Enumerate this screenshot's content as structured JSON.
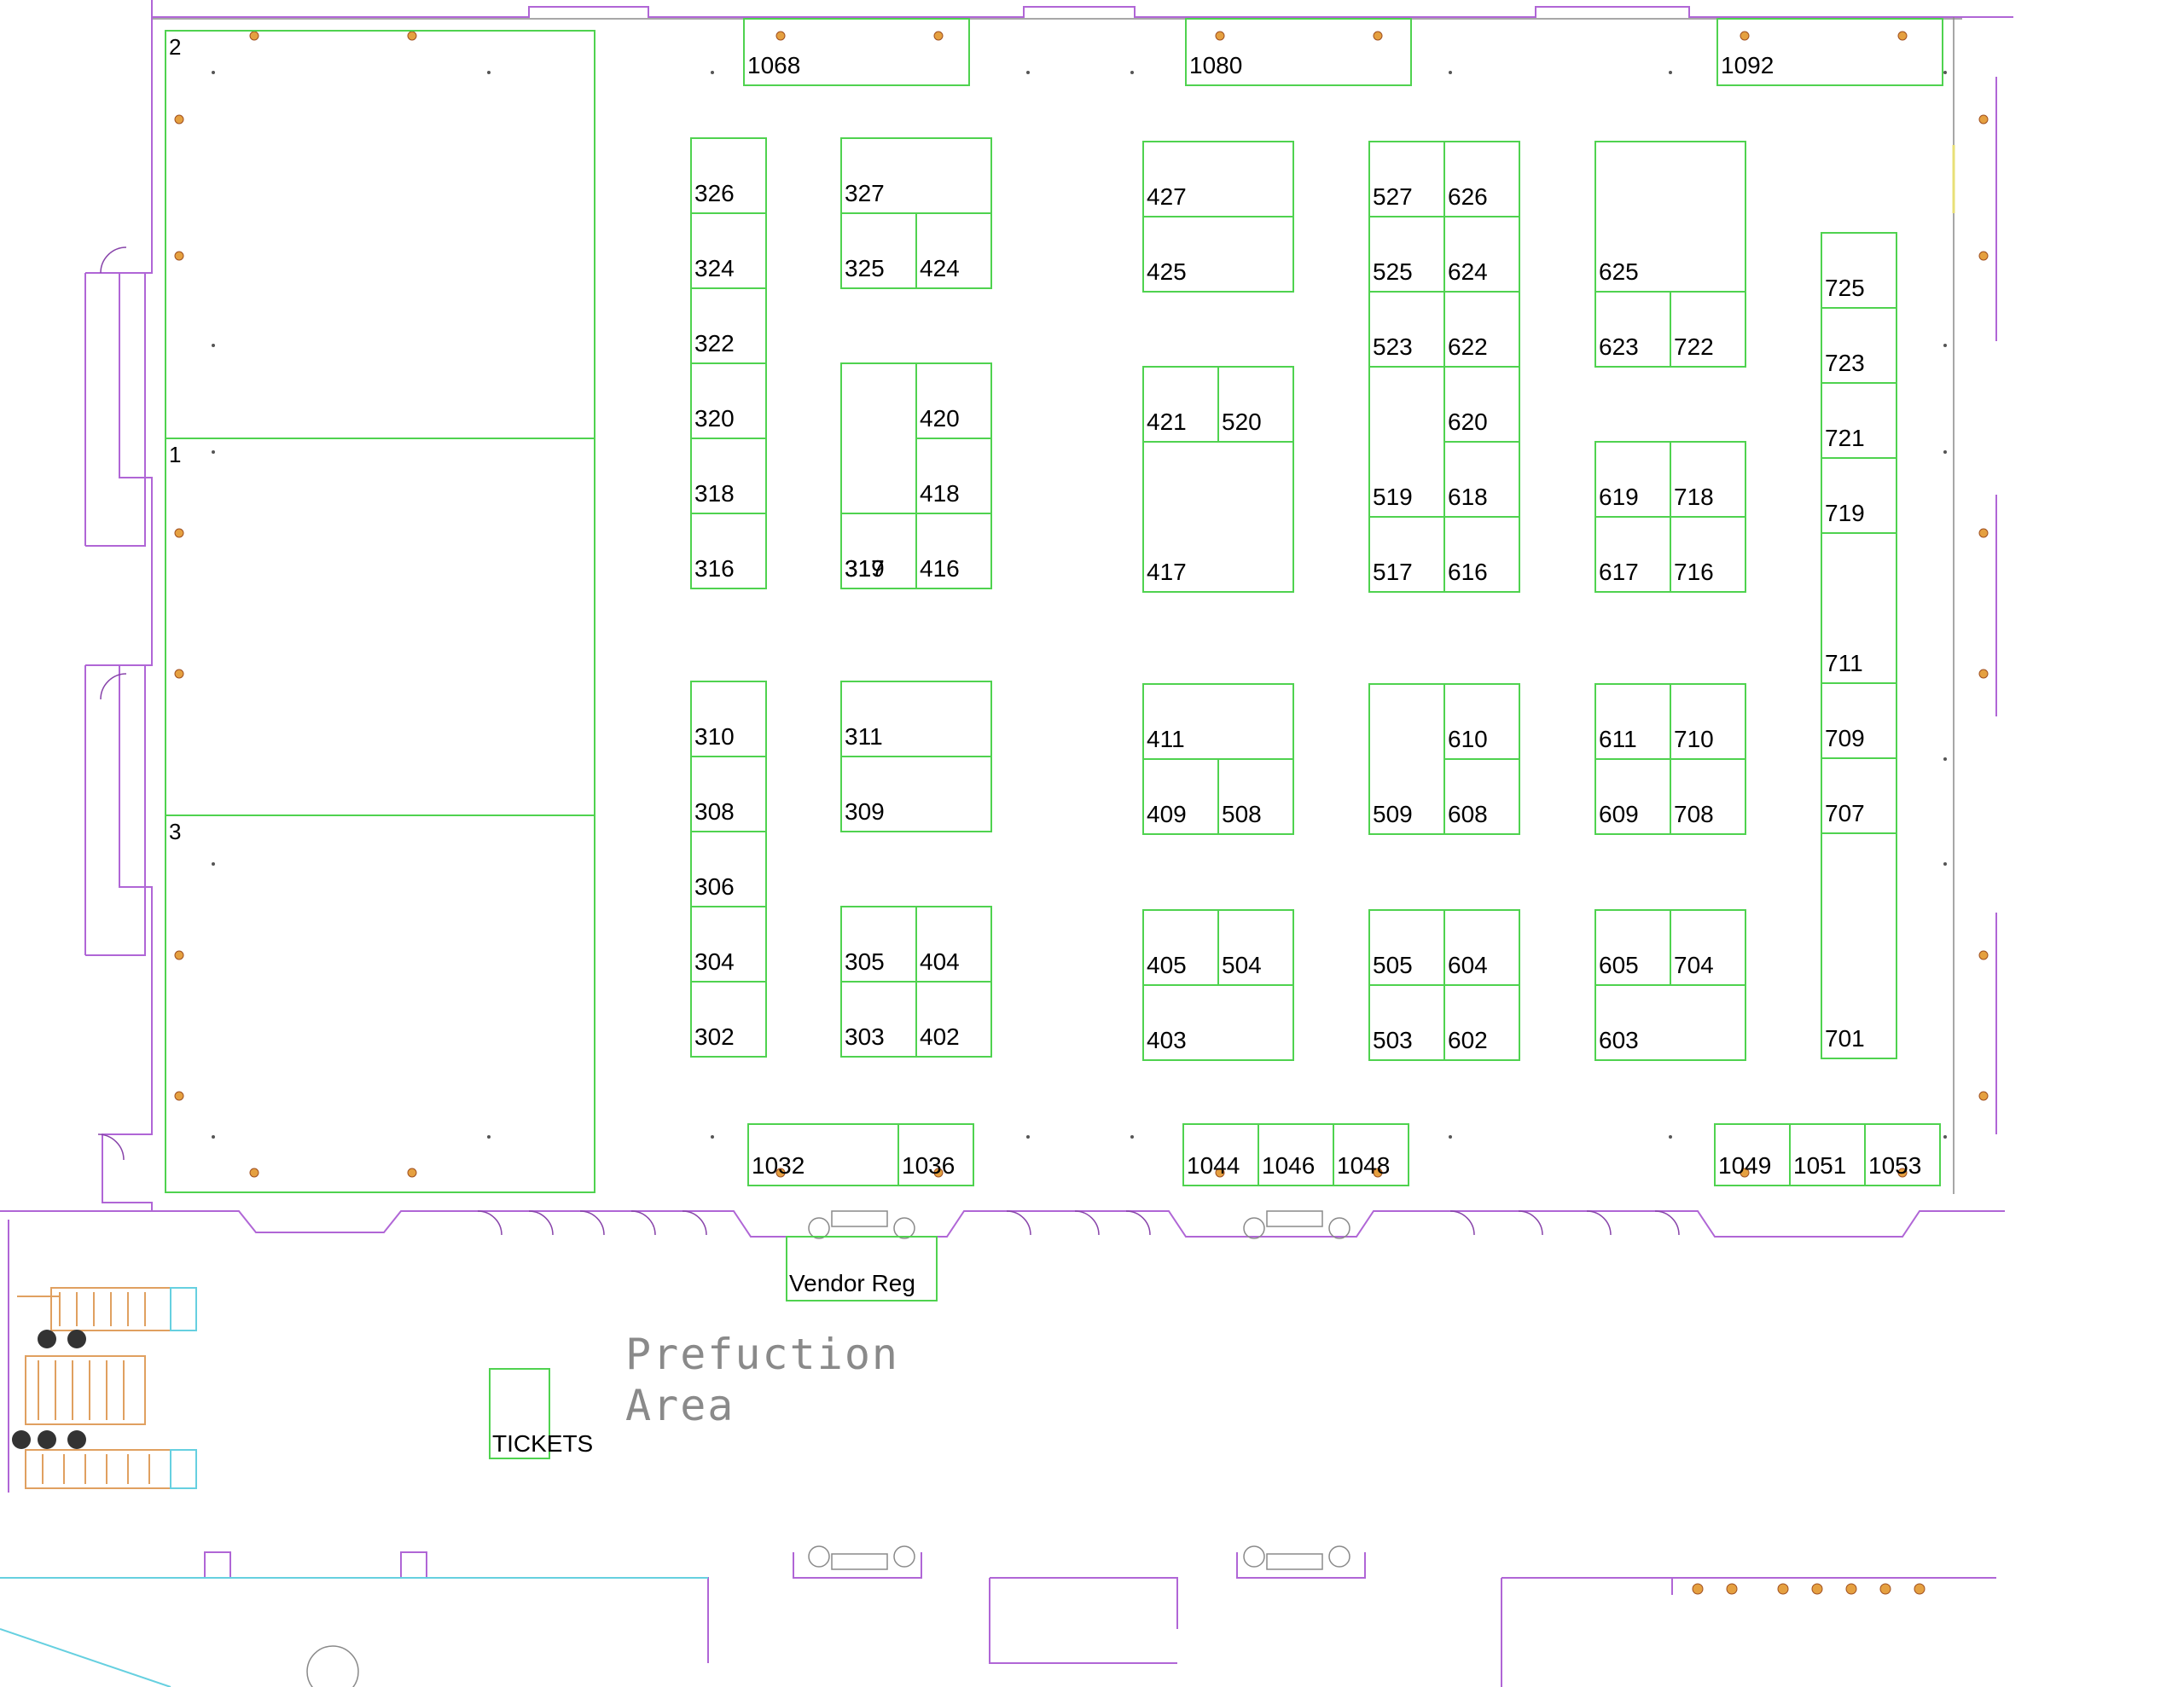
{
  "map": {
    "rooms": [
      {
        "label": "2"
      },
      {
        "label": "1"
      },
      {
        "label": "3"
      }
    ],
    "booths": [
      {
        "label": "1068"
      },
      {
        "label": "1080"
      },
      {
        "label": "1092"
      },
      {
        "label": "326"
      },
      {
        "label": "324"
      },
      {
        "label": "322"
      },
      {
        "label": "320"
      },
      {
        "label": "318"
      },
      {
        "label": "316"
      },
      {
        "label": "327"
      },
      {
        "label": "325"
      },
      {
        "label": "424"
      },
      {
        "label": "420"
      },
      {
        "label": "319"
      },
      {
        "label": "418"
      },
      {
        "label": "317"
      },
      {
        "label": "416"
      },
      {
        "label": "427"
      },
      {
        "label": "425"
      },
      {
        "label": "421"
      },
      {
        "label": "520"
      },
      {
        "label": "417"
      },
      {
        "label": "527"
      },
      {
        "label": "626"
      },
      {
        "label": "525"
      },
      {
        "label": "624"
      },
      {
        "label": "523"
      },
      {
        "label": "622"
      },
      {
        "label": "620"
      },
      {
        "label": "519"
      },
      {
        "label": "618"
      },
      {
        "label": "517"
      },
      {
        "label": "616"
      },
      {
        "label": "625"
      },
      {
        "label": "623"
      },
      {
        "label": "722"
      },
      {
        "label": "619"
      },
      {
        "label": "718"
      },
      {
        "label": "617"
      },
      {
        "label": "716"
      },
      {
        "label": "725"
      },
      {
        "label": "723"
      },
      {
        "label": "721"
      },
      {
        "label": "719"
      },
      {
        "label": "711"
      },
      {
        "label": "709"
      },
      {
        "label": "707"
      },
      {
        "label": "701"
      },
      {
        "label": "310"
      },
      {
        "label": "308"
      },
      {
        "label": "306"
      },
      {
        "label": "304"
      },
      {
        "label": "302"
      },
      {
        "label": "311"
      },
      {
        "label": "309"
      },
      {
        "label": "305"
      },
      {
        "label": "404"
      },
      {
        "label": "303"
      },
      {
        "label": "402"
      },
      {
        "label": "411"
      },
      {
        "label": "409"
      },
      {
        "label": "508"
      },
      {
        "label": "405"
      },
      {
        "label": "504"
      },
      {
        "label": "403"
      },
      {
        "label": "610"
      },
      {
        "label": "509"
      },
      {
        "label": "608"
      },
      {
        "label": "505"
      },
      {
        "label": "604"
      },
      {
        "label": "503"
      },
      {
        "label": "602"
      },
      {
        "label": "611"
      },
      {
        "label": "710"
      },
      {
        "label": "609"
      },
      {
        "label": "708"
      },
      {
        "label": "605"
      },
      {
        "label": "704"
      },
      {
        "label": "603"
      },
      {
        "label": "1032"
      },
      {
        "label": "1036"
      },
      {
        "label": "1044"
      },
      {
        "label": "1046"
      },
      {
        "label": "1048"
      },
      {
        "label": "1049"
      },
      {
        "label": "1051"
      },
      {
        "label": "1053"
      }
    ],
    "vendor_reg": "Vendor Reg",
    "tickets": "TICKETS",
    "prefunction_line1": "Prefuction",
    "prefunction_line2": "Area",
    "colors": {
      "booth_outline": "#4fd24f",
      "wall": "#b066d6",
      "prefunction_text": "#8a8a8a"
    }
  }
}
